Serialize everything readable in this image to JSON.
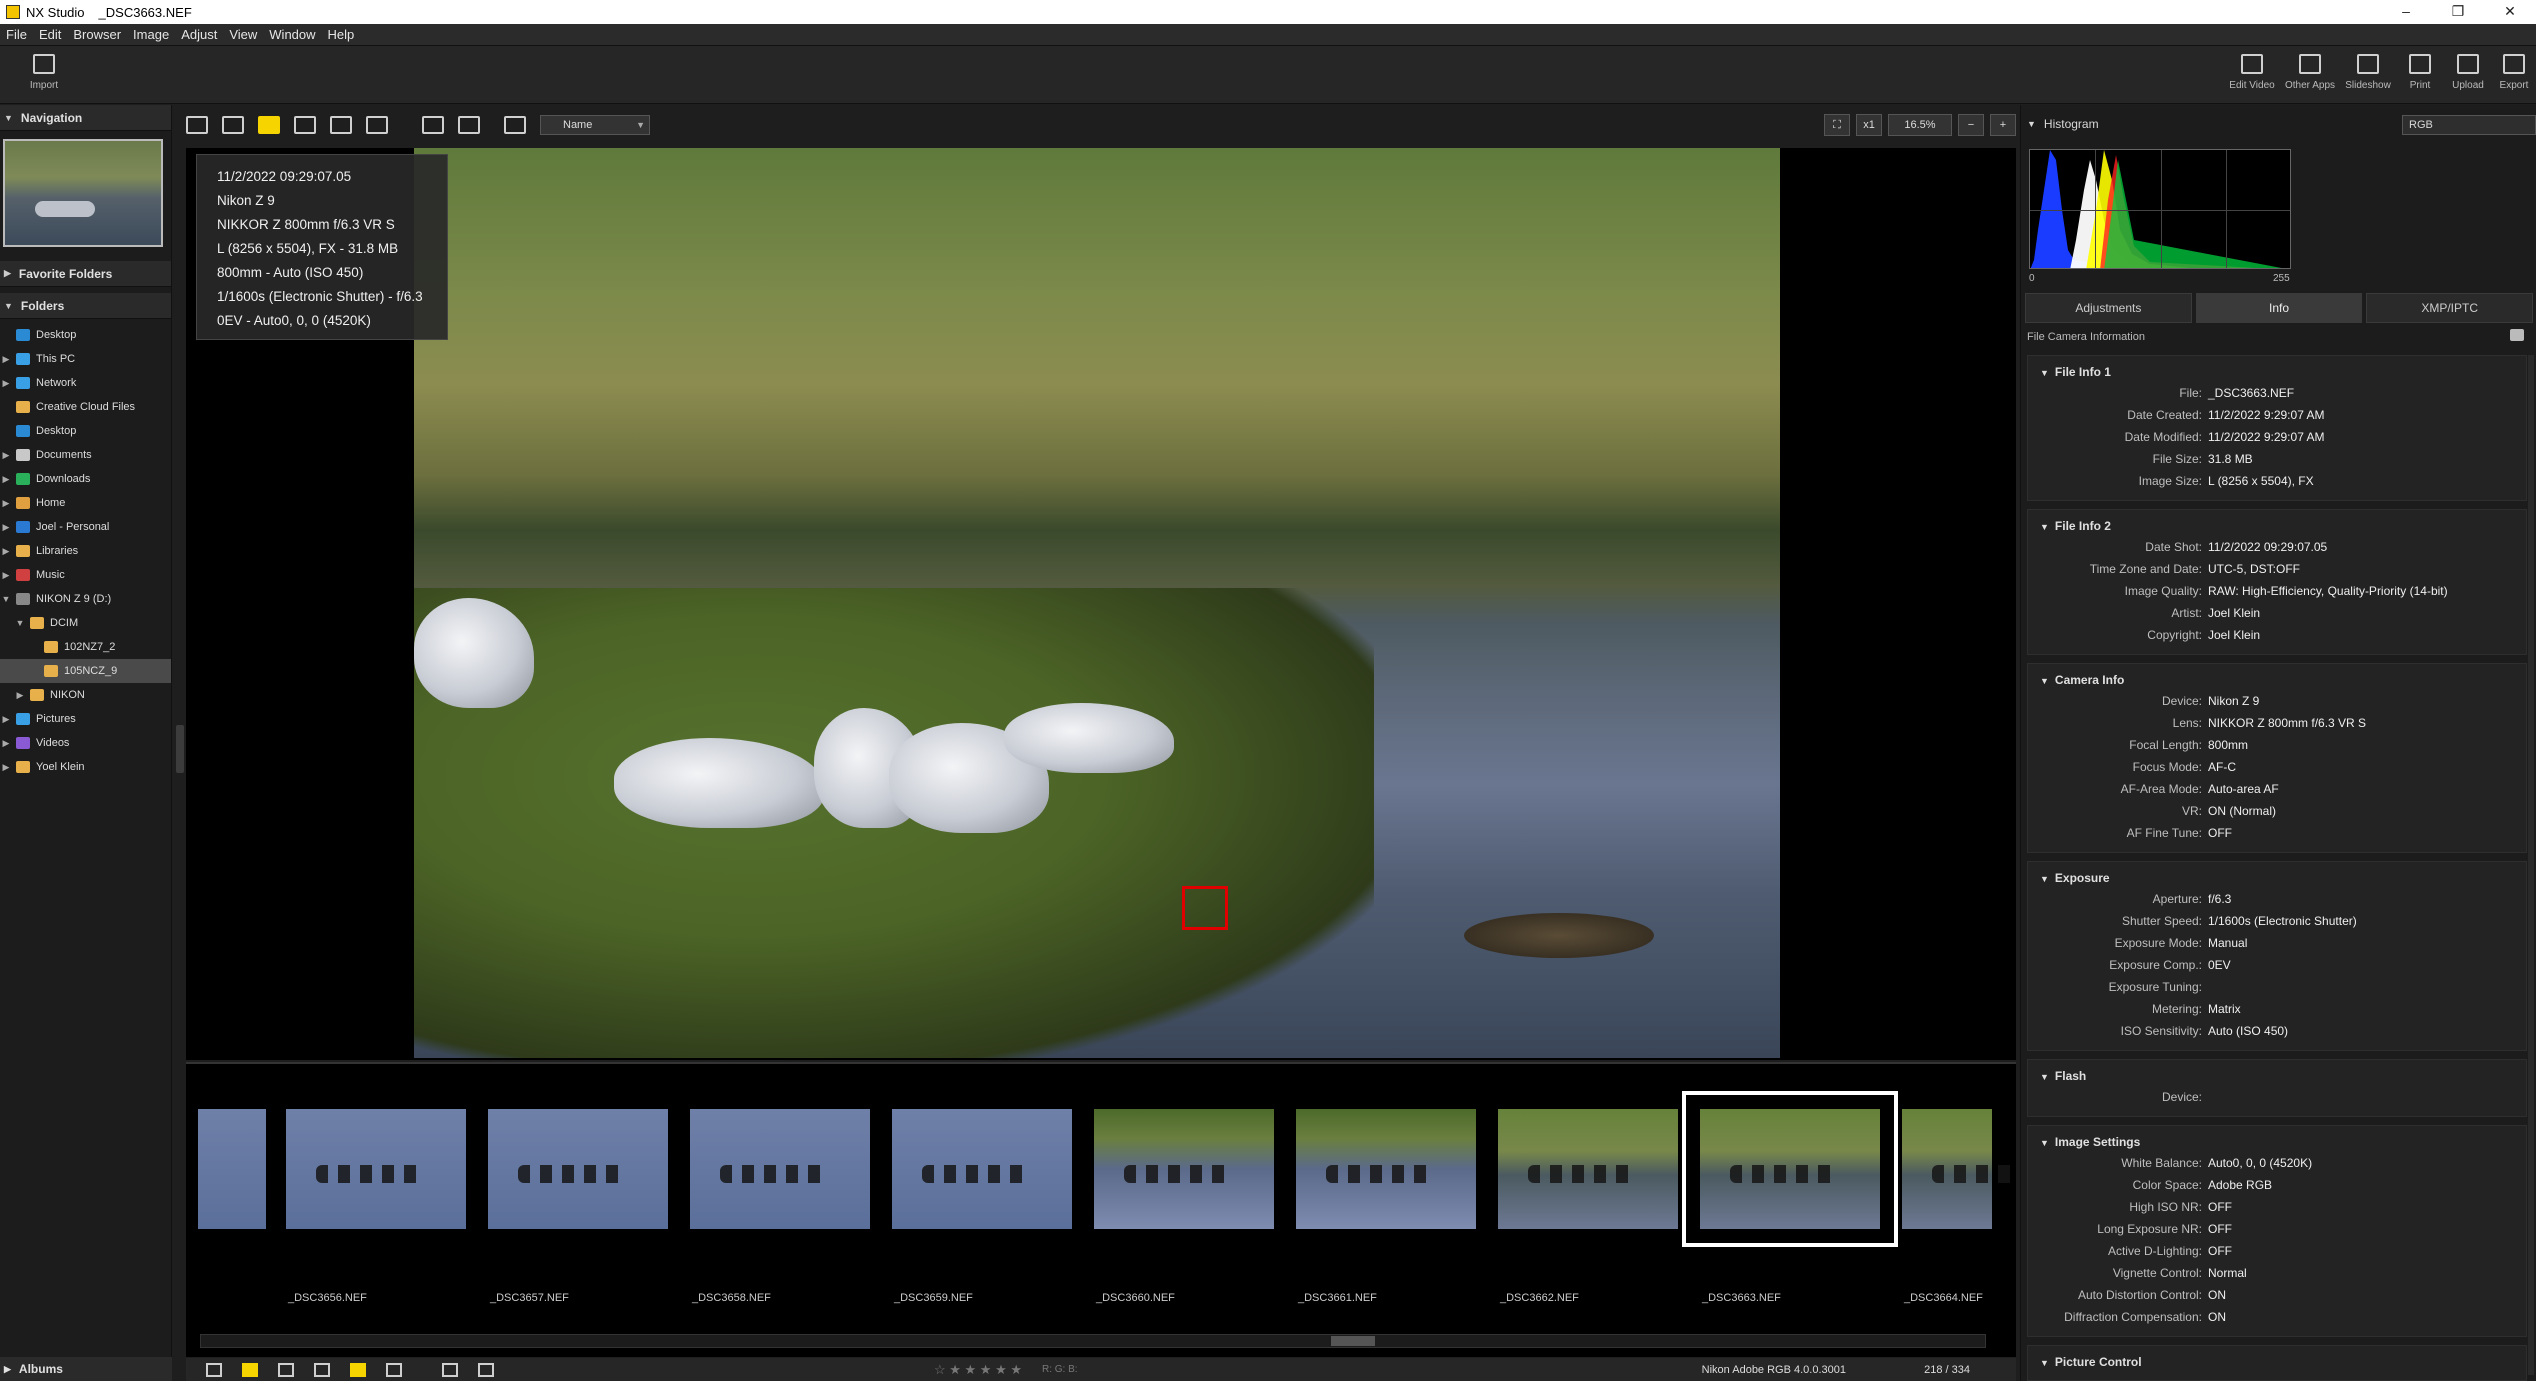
{
  "window": {
    "app_name": "NX Studio",
    "file_name": "_DSC3663.NEF",
    "controls": [
      "–",
      "❐",
      "✕"
    ]
  },
  "menu": [
    "File",
    "Edit",
    "Browser",
    "Image",
    "Adjust",
    "View",
    "Window",
    "Help"
  ],
  "toolbar": {
    "import_label": "Import",
    "right_buttons": [
      "Edit Video",
      "Other Apps",
      "Slideshow",
      "Print",
      "Upload",
      "Export"
    ]
  },
  "left_panel": {
    "navigation": "Navigation",
    "favorite_folders": "Favorite Folders",
    "folders": "Folders",
    "albums": "Albums",
    "tree": [
      {
        "label": "Desktop",
        "color": "#2a8ad4",
        "arrow": ""
      },
      {
        "label": "This PC",
        "color": "#3aa0e6",
        "arrow": "▶"
      },
      {
        "label": "Network",
        "color": "#3aa0e6",
        "arrow": "▶"
      },
      {
        "label": "Creative Cloud Files",
        "color": "#e8b04a",
        "arrow": ""
      },
      {
        "label": "Desktop",
        "color": "#2a8ad4",
        "arrow": ""
      },
      {
        "label": "Documents",
        "color": "#c8c8c8",
        "arrow": "▶"
      },
      {
        "label": "Downloads",
        "color": "#2ab05a",
        "arrow": "▶"
      },
      {
        "label": "Home",
        "color": "#e0a040",
        "arrow": "▶"
      },
      {
        "label": "Joel - Personal",
        "color": "#2a7ad4",
        "arrow": "▶"
      },
      {
        "label": "Libraries",
        "color": "#e8b04a",
        "arrow": "▶"
      },
      {
        "label": "Music",
        "color": "#d04040",
        "arrow": "▶"
      },
      {
        "label": "NIKON Z 9   (D:)",
        "color": "#888888",
        "arrow": "▼"
      },
      {
        "label": "DCIM",
        "color": "#e8b04a",
        "arrow": "▼"
      },
      {
        "label": "102NZ7_2",
        "color": "#e8b04a",
        "arrow": ""
      },
      {
        "label": "105NCZ_9",
        "color": "#e8b04a",
        "arrow": ""
      },
      {
        "label": "NIKON",
        "color": "#e8b04a",
        "arrow": "▶"
      },
      {
        "label": "Pictures",
        "color": "#3aa0e6",
        "arrow": "▶"
      },
      {
        "label": "Videos",
        "color": "#8a5ad4",
        "arrow": "▶"
      },
      {
        "label": "Yoel Klein",
        "color": "#e8b04a",
        "arrow": "▶"
      }
    ]
  },
  "viewbar": {
    "sort_label": "Name",
    "zoom_x": "x1",
    "zoom_pct": "16.5%"
  },
  "overlay_info": [
    "11/2/2022 09:29:07.05",
    "Nikon Z 9",
    "NIKKOR Z 800mm f/6.3 VR S",
    "L (8256 x 5504), FX - 31.8 MB",
    "800mm - Auto (ISO 450)",
    "1/1600s (Electronic Shutter) - f/6.3",
    "0EV - Auto0, 0, 0 (4520K)"
  ],
  "filmstrip": [
    {
      "label": "",
      "style": "water"
    },
    {
      "label": "_DSC3656.NEF",
      "style": "water"
    },
    {
      "label": "_DSC3657.NEF",
      "style": "water"
    },
    {
      "label": "_DSC3658.NEF",
      "style": "water"
    },
    {
      "label": "_DSC3659.NEF",
      "style": "water"
    },
    {
      "label": "_DSC3660.NEF",
      "style": "grassy2"
    },
    {
      "label": "_DSC3661.NEF",
      "style": "grassy2"
    },
    {
      "label": "_DSC3662.NEF",
      "style": "grass"
    },
    {
      "label": "_DSC3663.NEF",
      "style": "grass",
      "selected": true
    },
    {
      "label": "_DSC3664.NEF",
      "style": "grass"
    }
  ],
  "bottombar": {
    "stars": "☆ ★ ★ ★ ★ ★",
    "rgb": "R:      G:      B:",
    "profile": "Nikon Adobe RGB 4.0.0.3001",
    "page": "218 / 334"
  },
  "right_panel": {
    "histogram": "Histogram",
    "channel": "RGB",
    "hist_min": "0",
    "hist_max": "255",
    "tabs": [
      "Adjustments",
      "Info",
      "XMP/IPTC"
    ],
    "sub_header": "File  Camera Information",
    "sections": [
      {
        "title": "File Info 1",
        "rows": [
          [
            "File:",
            "_DSC3663.NEF"
          ],
          [
            "Date Created:",
            "11/2/2022 9:29:07 AM"
          ],
          [
            "Date Modified:",
            "11/2/2022 9:29:07 AM"
          ],
          [
            "File Size:",
            "31.8 MB"
          ],
          [
            "Image Size:",
            "L (8256 x 5504), FX"
          ]
        ]
      },
      {
        "title": "File Info 2",
        "rows": [
          [
            "Date Shot:",
            "11/2/2022 09:29:07.05"
          ],
          [
            "Time Zone and Date:",
            "UTC-5, DST:OFF"
          ],
          [
            "Image Quality:",
            "RAW: High-Efficiency, Quality-Priority (14-bit)"
          ],
          [
            "Artist:",
            "Joel Klein"
          ],
          [
            "Copyright:",
            "Joel Klein"
          ]
        ]
      },
      {
        "title": "Camera Info",
        "rows": [
          [
            "Device:",
            "Nikon Z 9"
          ],
          [
            "Lens:",
            "NIKKOR Z 800mm f/6.3 VR S"
          ],
          [
            "Focal Length:",
            "800mm"
          ],
          [
            "Focus Mode:",
            "AF-C"
          ],
          [
            "AF-Area Mode:",
            "Auto-area AF"
          ],
          [
            "VR:",
            "ON (Normal)"
          ],
          [
            "AF Fine Tune:",
            "OFF"
          ]
        ]
      },
      {
        "title": "Exposure",
        "rows": [
          [
            "Aperture:",
            "f/6.3"
          ],
          [
            "Shutter Speed:",
            "1/1600s (Electronic Shutter)"
          ],
          [
            "Exposure Mode:",
            "Manual"
          ],
          [
            "Exposure Comp.:",
            "0EV"
          ],
          [
            "Exposure Tuning:",
            ""
          ],
          [
            "Metering:",
            "Matrix"
          ],
          [
            "ISO Sensitivity:",
            "Auto (ISO 450)"
          ]
        ]
      },
      {
        "title": "Flash",
        "rows": [
          [
            "Device:",
            ""
          ]
        ]
      },
      {
        "title": "Image Settings",
        "rows": [
          [
            "White Balance:",
            "Auto0, 0, 0 (4520K)"
          ],
          [
            "Color Space:",
            "Adobe RGB"
          ],
          [
            "High ISO NR:",
            "OFF"
          ],
          [
            "Long Exposure NR:",
            "OFF"
          ],
          [
            "Active D-Lighting:",
            "OFF"
          ],
          [
            "Vignette Control:",
            "Normal"
          ],
          [
            "Auto Distortion Control:",
            "ON"
          ],
          [
            "Diffraction Compensation:",
            "ON"
          ]
        ]
      },
      {
        "title": "Picture Control",
        "rows": []
      }
    ]
  }
}
